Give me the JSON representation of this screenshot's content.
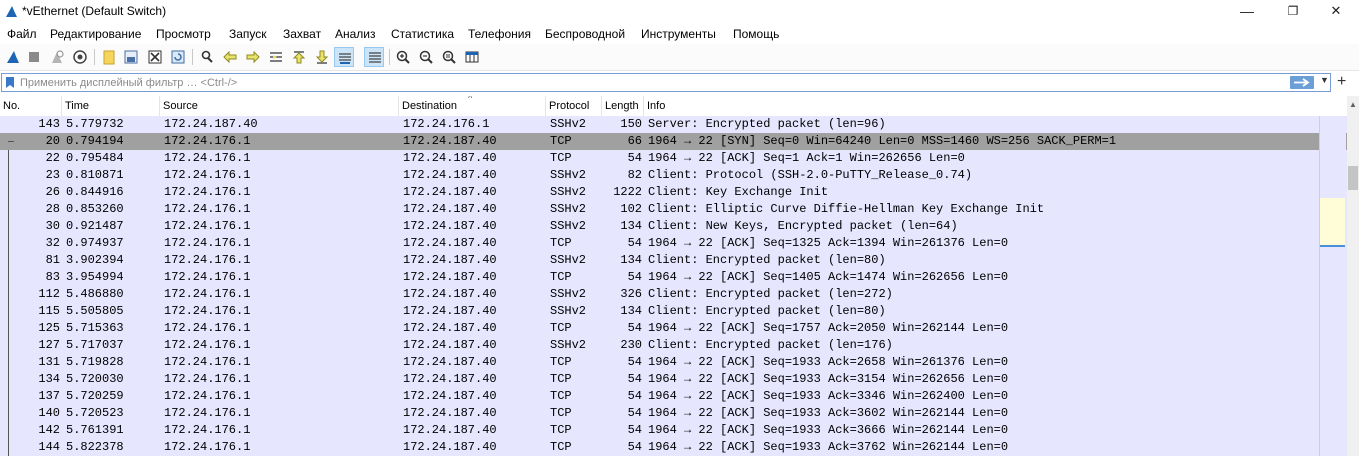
{
  "window": {
    "title": "*vEthernet (Default Switch)",
    "minimize": "—",
    "maximize": "❐",
    "close": "✕"
  },
  "menu": [
    "Файл",
    "Редактирование",
    "Просмотр",
    "Запуск",
    "Захват",
    "Анализ",
    "Статистика",
    "Телефония",
    "Беспроводной",
    "Инструменты",
    "Помощь"
  ],
  "filter": {
    "placeholder": "Применить дисплейный фильтр … <Ctrl-/>",
    "value": ""
  },
  "columns": [
    "No.",
    "Time",
    "Source",
    "Destination",
    "Protocol",
    "Length",
    "Info"
  ],
  "packets": [
    {
      "no": "143",
      "time": "5.779732",
      "src": "172.24.187.40",
      "dst": "172.24.176.1",
      "proto": "SSHv2",
      "len": "150",
      "info": "Server: Encrypted packet (len=96)",
      "selected": false
    },
    {
      "no": "20",
      "time": "0.794194",
      "src": "172.24.176.1",
      "dst": "172.24.187.40",
      "proto": "TCP",
      "len": "66",
      "info": "1964 → 22 [SYN] Seq=0 Win=64240 Len=0 MSS=1460 WS=256 SACK_PERM=1",
      "selected": true
    },
    {
      "no": "22",
      "time": "0.795484",
      "src": "172.24.176.1",
      "dst": "172.24.187.40",
      "proto": "TCP",
      "len": "54",
      "info": "1964 → 22 [ACK] Seq=1 Ack=1 Win=262656 Len=0",
      "selected": false
    },
    {
      "no": "23",
      "time": "0.810871",
      "src": "172.24.176.1",
      "dst": "172.24.187.40",
      "proto": "SSHv2",
      "len": "82",
      "info": "Client: Protocol (SSH-2.0-PuTTY_Release_0.74)",
      "selected": false
    },
    {
      "no": "26",
      "time": "0.844916",
      "src": "172.24.176.1",
      "dst": "172.24.187.40",
      "proto": "SSHv2",
      "len": "1222",
      "info": "Client: Key Exchange Init",
      "selected": false
    },
    {
      "no": "28",
      "time": "0.853260",
      "src": "172.24.176.1",
      "dst": "172.24.187.40",
      "proto": "SSHv2",
      "len": "102",
      "info": "Client: Elliptic Curve Diffie-Hellman Key Exchange Init",
      "selected": false
    },
    {
      "no": "30",
      "time": "0.921487",
      "src": "172.24.176.1",
      "dst": "172.24.187.40",
      "proto": "SSHv2",
      "len": "134",
      "info": "Client: New Keys, Encrypted packet (len=64)",
      "selected": false
    },
    {
      "no": "32",
      "time": "0.974937",
      "src": "172.24.176.1",
      "dst": "172.24.187.40",
      "proto": "TCP",
      "len": "54",
      "info": "1964 → 22 [ACK] Seq=1325 Ack=1394 Win=261376 Len=0",
      "selected": false
    },
    {
      "no": "81",
      "time": "3.902394",
      "src": "172.24.176.1",
      "dst": "172.24.187.40",
      "proto": "SSHv2",
      "len": "134",
      "info": "Client: Encrypted packet (len=80)",
      "selected": false
    },
    {
      "no": "83",
      "time": "3.954994",
      "src": "172.24.176.1",
      "dst": "172.24.187.40",
      "proto": "TCP",
      "len": "54",
      "info": "1964 → 22 [ACK] Seq=1405 Ack=1474 Win=262656 Len=0",
      "selected": false
    },
    {
      "no": "112",
      "time": "5.486880",
      "src": "172.24.176.1",
      "dst": "172.24.187.40",
      "proto": "SSHv2",
      "len": "326",
      "info": "Client: Encrypted packet (len=272)",
      "selected": false
    },
    {
      "no": "115",
      "time": "5.505805",
      "src": "172.24.176.1",
      "dst": "172.24.187.40",
      "proto": "SSHv2",
      "len": "134",
      "info": "Client: Encrypted packet (len=80)",
      "selected": false
    },
    {
      "no": "125",
      "time": "5.715363",
      "src": "172.24.176.1",
      "dst": "172.24.187.40",
      "proto": "TCP",
      "len": "54",
      "info": "1964 → 22 [ACK] Seq=1757 Ack=2050 Win=262144 Len=0",
      "selected": false
    },
    {
      "no": "127",
      "time": "5.717037",
      "src": "172.24.176.1",
      "dst": "172.24.187.40",
      "proto": "SSHv2",
      "len": "230",
      "info": "Client: Encrypted packet (len=176)",
      "selected": false
    },
    {
      "no": "131",
      "time": "5.719828",
      "src": "172.24.176.1",
      "dst": "172.24.187.40",
      "proto": "TCP",
      "len": "54",
      "info": "1964 → 22 [ACK] Seq=1933 Ack=2658 Win=261376 Len=0",
      "selected": false
    },
    {
      "no": "134",
      "time": "5.720030",
      "src": "172.24.176.1",
      "dst": "172.24.187.40",
      "proto": "TCP",
      "len": "54",
      "info": "1964 → 22 [ACK] Seq=1933 Ack=3154 Win=262656 Len=0",
      "selected": false
    },
    {
      "no": "137",
      "time": "5.720259",
      "src": "172.24.176.1",
      "dst": "172.24.187.40",
      "proto": "TCP",
      "len": "54",
      "info": "1964 → 22 [ACK] Seq=1933 Ack=3346 Win=262400 Len=0",
      "selected": false
    },
    {
      "no": "140",
      "time": "5.720523",
      "src": "172.24.176.1",
      "dst": "172.24.187.40",
      "proto": "TCP",
      "len": "54",
      "info": "1964 → 22 [ACK] Seq=1933 Ack=3602 Win=262144 Len=0",
      "selected": false
    },
    {
      "no": "142",
      "time": "5.761391",
      "src": "172.24.176.1",
      "dst": "172.24.187.40",
      "proto": "TCP",
      "len": "54",
      "info": "1964 → 22 [ACK] Seq=1933 Ack=3666 Win=262144 Len=0",
      "selected": false
    },
    {
      "no": "144",
      "time": "5.822378",
      "src": "172.24.176.1",
      "dst": "172.24.187.40",
      "proto": "TCP",
      "len": "54",
      "info": "1964 → 22 [ACK] Seq=1933 Ack=3762 Win=262144 Len=0",
      "selected": false
    }
  ],
  "colors": {
    "row_bg": "#e7e6ff",
    "selected_bg": "#a0a0a0",
    "accent": "#1c64b4"
  },
  "toolbar_icons": [
    "shark-fin-start-icon",
    "stop-icon",
    "restart-icon",
    "capture-options-icon",
    "open-file-icon",
    "save-file-icon",
    "close-file-icon",
    "reload-icon",
    "find-icon",
    "go-back-icon",
    "go-forward-icon",
    "go-to-packet-icon",
    "go-first-icon",
    "go-last-icon",
    "autoscroll-icon",
    "colorize-icon",
    "zoom-in-icon",
    "zoom-out-icon",
    "zoom-normal-icon",
    "resize-columns-icon"
  ]
}
